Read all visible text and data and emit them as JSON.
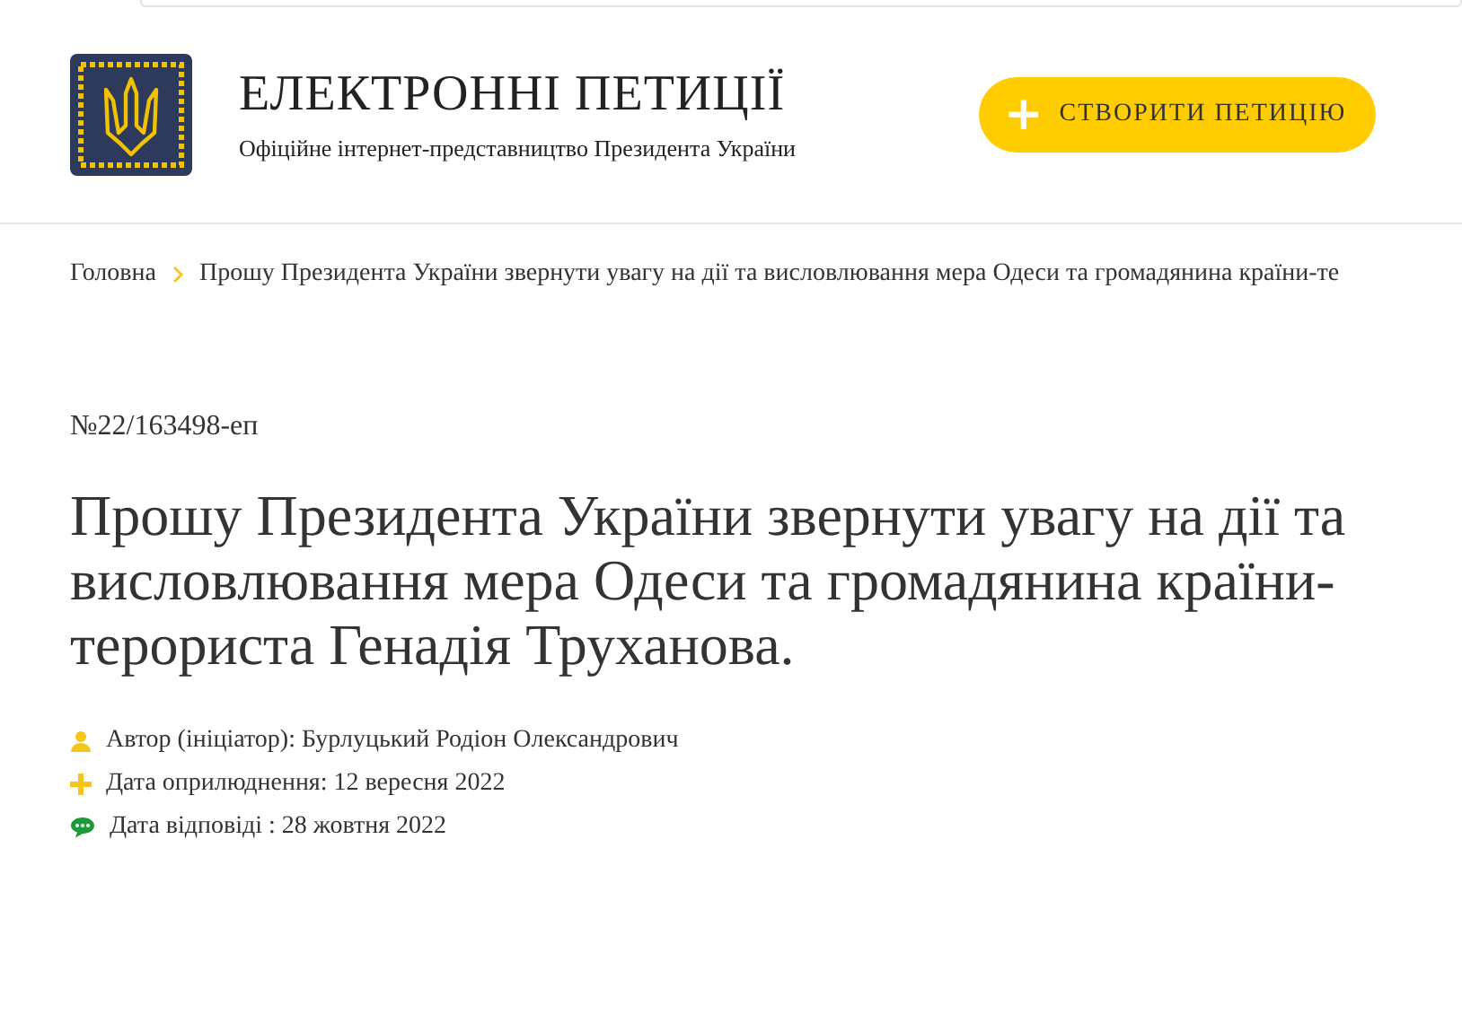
{
  "header": {
    "title": "ЕЛЕКТРОННІ ПЕТИЦІЇ",
    "subtitle": "Офіційне інтернет-представництво Президента України",
    "create_button": {
      "icon": "+",
      "label": "СТВОРИТИ ПЕТИЦІЮ"
    }
  },
  "breadcrumbs": [
    {
      "label": "Головна"
    },
    {
      "label": "Прошу Президента України звернути увагу на дії та висловлювання мера Одеси та громадянина країни-те"
    }
  ],
  "petition": {
    "number": "№22/163498-еп",
    "title": "Прошу Президента України звернути увагу на дії та висловлювання мера Одеси та громадянина країни-терориста Генадія Труханова.",
    "meta": [
      {
        "kind": "author",
        "text": "Автор (ініціатор): Бурлуцький Родіон Олександрович"
      },
      {
        "kind": "published",
        "text": "Дата оприлюднення: 12 вересня 2022"
      },
      {
        "kind": "answered",
        "text": "Дата відповіді : 28 жовтня 2022"
      }
    ]
  }
}
